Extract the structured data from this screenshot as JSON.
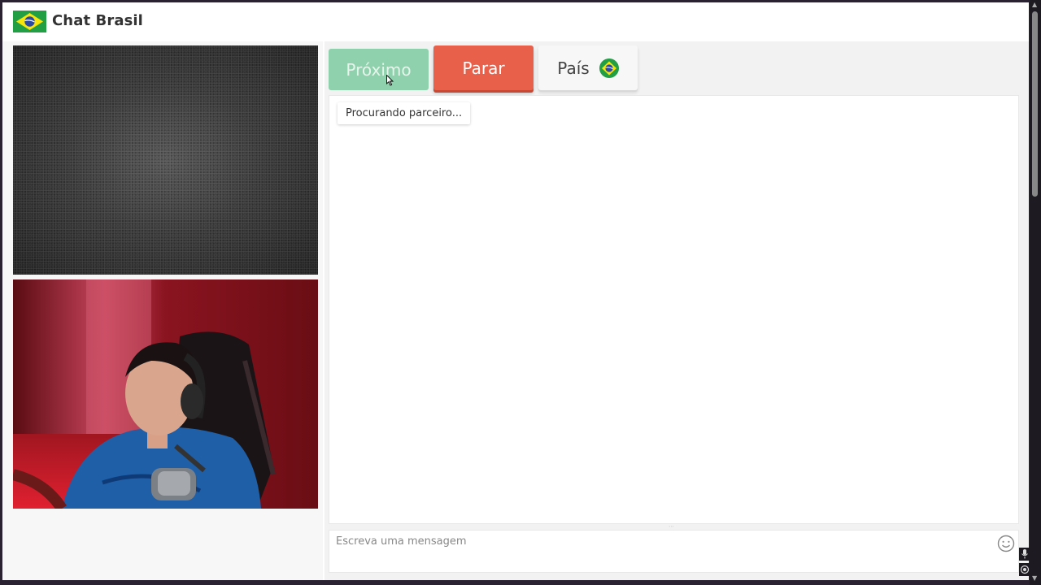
{
  "header": {
    "brand": "Chat Brasil",
    "flag_icon": "brazil-flag-icon"
  },
  "controls": {
    "next_label": "Próximo",
    "stop_label": "Parar",
    "country_label": "País",
    "country_flag_icon": "brazil-flag-icon"
  },
  "chat": {
    "status_message": "Procurando parceiro..."
  },
  "composer": {
    "placeholder": "Escreva uma mensagem",
    "value": "",
    "emoji_icon": "smiley-icon"
  },
  "colors": {
    "next": "#8fd1ad",
    "stop": "#e8604a",
    "country": "#f7f7f7",
    "page_bg": "#ffffff",
    "frame": "#2a2231"
  }
}
